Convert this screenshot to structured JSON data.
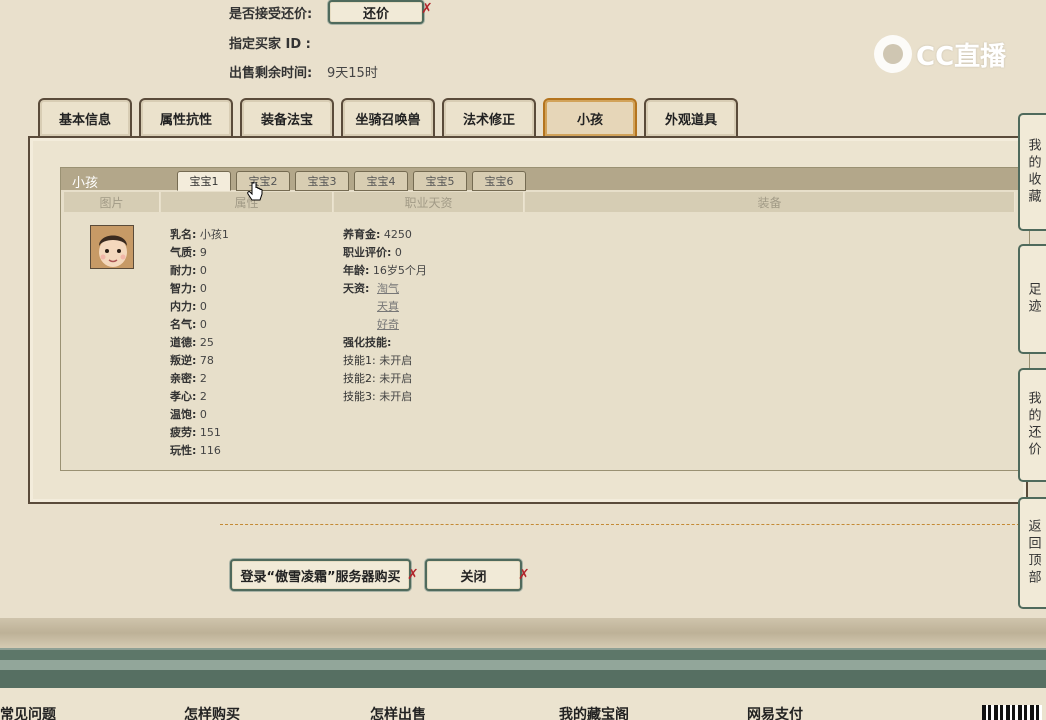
{
  "info": {
    "accept_bargain_label": "是否接受还价:",
    "bargain_button": "还价",
    "buyer_id_label": "指定买家 ID :",
    "remaining_label": "出售剩余时间:",
    "remaining_value": "9天15时"
  },
  "logo": {
    "text": "CC直播"
  },
  "tabs": [
    "基本信息",
    "属性抗性",
    "装备法宝",
    "坐骑召唤兽",
    "法术修正",
    "小孩",
    "外观道具"
  ],
  "active_tab": "小孩",
  "child_panel": {
    "title": "小孩",
    "subtabs": [
      "宝宝1",
      "宝宝2",
      "宝宝3",
      "宝宝4",
      "宝宝5",
      "宝宝6"
    ],
    "columns": [
      "图片",
      "属性",
      "职业天资",
      "装备"
    ],
    "attributes": [
      {
        "label": "乳名:",
        "value": "小孩1"
      },
      {
        "label": "气质:",
        "value": "9"
      },
      {
        "label": "耐力:",
        "value": "0"
      },
      {
        "label": "智力:",
        "value": "0"
      },
      {
        "label": "内力:",
        "value": "0"
      },
      {
        "label": "名气:",
        "value": "0"
      },
      {
        "label": "道德:",
        "value": "25"
      },
      {
        "label": "叛逆:",
        "value": "78"
      },
      {
        "label": "亲密:",
        "value": "2"
      },
      {
        "label": "孝心:",
        "value": "2"
      },
      {
        "label": "温饱:",
        "value": "0"
      },
      {
        "label": "疲劳:",
        "value": "151"
      },
      {
        "label": "玩性:",
        "value": "116"
      }
    ],
    "career": {
      "raise_gold_label": "养育金:",
      "raise_gold_value": "4250",
      "rating_label": "职业评价:",
      "rating_value": "0",
      "age_label": "年龄:",
      "age_value": "16岁5个月",
      "talent_label": "天资:",
      "talents": [
        "淘气",
        "天真",
        "好奇"
      ],
      "skill_header": "强化技能:",
      "skills": [
        {
          "label": "技能1:",
          "value": "未开启"
        },
        {
          "label": "技能2:",
          "value": "未开启"
        },
        {
          "label": "技能3:",
          "value": "未开启"
        }
      ]
    }
  },
  "buttons": {
    "login_buy": "登录“傲雪凌霜”服务器购买",
    "close": "关闭"
  },
  "sidenav": [
    {
      "label": "我的收藏"
    },
    {
      "label": "足迹"
    },
    {
      "label": "我的还价"
    },
    {
      "label": "返回顶部"
    }
  ],
  "footer": [
    "常见问题",
    "怎样购买",
    "怎样出售",
    "我的藏宝阁",
    "网易支付"
  ],
  "colors": {
    "accent_green": "#4f6a5c",
    "active_tab_border": "#b4741e",
    "mark_red": "#b2252c"
  }
}
